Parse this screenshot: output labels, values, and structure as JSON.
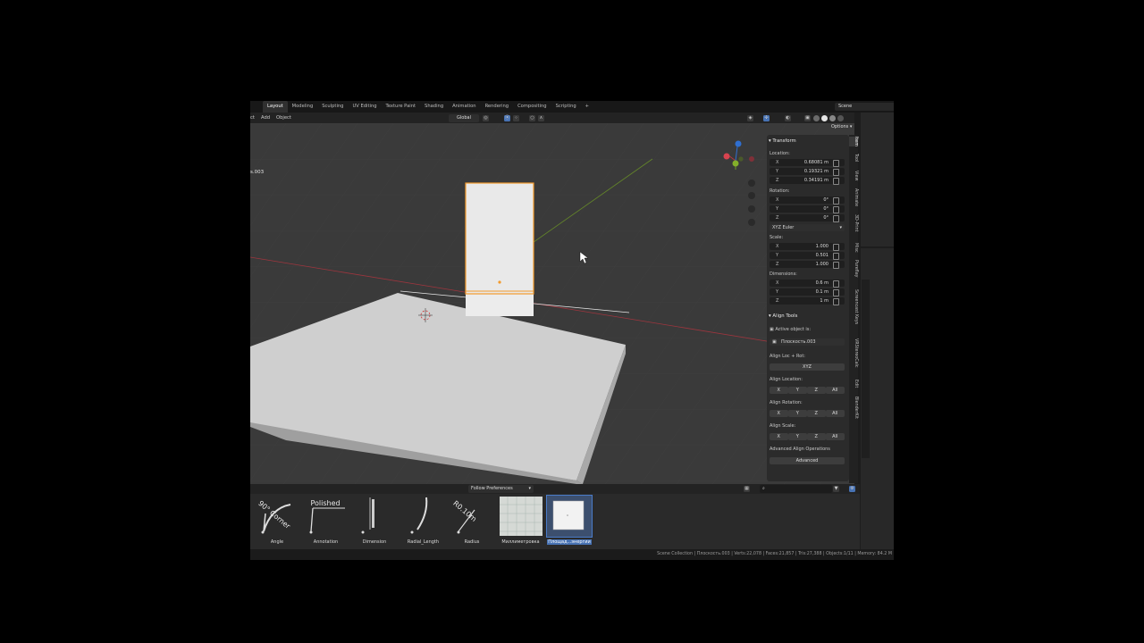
{
  "topbar": {
    "workspaces": [
      "Layout",
      "Modeling",
      "Sculpting",
      "UV Editing",
      "Texture Paint",
      "Shading",
      "Animation",
      "Rendering",
      "Compositing",
      "Scripting",
      "+"
    ],
    "active_workspace": "Layout",
    "scene": "Scene"
  },
  "header": {
    "menu_trunc": "ct",
    "menu_add": "Add",
    "menu_object": "Object",
    "orientation": "Global",
    "options": "Options"
  },
  "viewport": {
    "object_label": "s.003"
  },
  "npanel": {
    "transform_title": "Transform",
    "location_label": "Location:",
    "location": [
      {
        "ax": "X",
        "v": "0.68081 m"
      },
      {
        "ax": "Y",
        "v": "0.19321 m"
      },
      {
        "ax": "Z",
        "v": "0.34191 m"
      }
    ],
    "rotation_label": "Rotation:",
    "rotation": [
      {
        "ax": "X",
        "v": "0°"
      },
      {
        "ax": "Y",
        "v": "0°"
      },
      {
        "ax": "Z",
        "v": "0°"
      }
    ],
    "rotation_mode": "XYZ Euler",
    "scale_label": "Scale:",
    "scale": [
      {
        "ax": "X",
        "v": "1.000"
      },
      {
        "ax": "Y",
        "v": "0.501"
      },
      {
        "ax": "Z",
        "v": "1.000"
      }
    ],
    "dimensions_label": "Dimensions:",
    "dimensions": [
      {
        "ax": "X",
        "v": "0.6 m"
      },
      {
        "ax": "Y",
        "v": "0.1 m"
      },
      {
        "ax": "Z",
        "v": "1 m"
      }
    ],
    "align_title": "Align Tools",
    "active_object_label": "Active object is:",
    "active_object": "Плоскость.003",
    "align_locrot_label": "Align Loc + Rot:",
    "xyz_btn": "XYZ",
    "align_location_label": "Align Location:",
    "align_rotation_label": "Align Rotation:",
    "align_scale_label": "Align Scale:",
    "axis_buttons": [
      "X",
      "Y",
      "Z",
      "All"
    ],
    "advanced_label": "Advanced Align Operations",
    "advanced_btn": "Advanced"
  },
  "vtabs": [
    "Item",
    "Tool",
    "View",
    "Animate",
    "3D-Print",
    "Misc",
    "Pureflay",
    "Screencast Keys",
    "VRStereoCalc",
    "Edit",
    "BlenderKit"
  ],
  "asset_browser": {
    "library": "Follow Preferences",
    "assets": [
      {
        "label": "Angle",
        "thumb_text": "90° Corner"
      },
      {
        "label": "Annotation",
        "thumb_text": "Polished"
      },
      {
        "label": "Dimension",
        "thumb_text": ""
      },
      {
        "label": "Radial_Length",
        "thumb_text": ""
      },
      {
        "label": "Radius",
        "thumb_text": "R0.10m"
      },
      {
        "label": "Миллиметровка",
        "thumb_text": ""
      },
      {
        "label": "Площад...энергии",
        "thumb_text": ""
      }
    ],
    "selected_index": 6
  },
  "statusbar": {
    "text": "Scene Collection | Плоскость.003 | Verts:22,078 | Faces:21,857 | Tris:27,388 | Objects:1/11 | Memory: 84.2 M"
  },
  "colors": {
    "selection": "#f39a2c",
    "x_axis": "#b8343f",
    "y_axis": "#6f9a25",
    "z_axis": "#2f6fd1",
    "accent": "#4772b3"
  }
}
